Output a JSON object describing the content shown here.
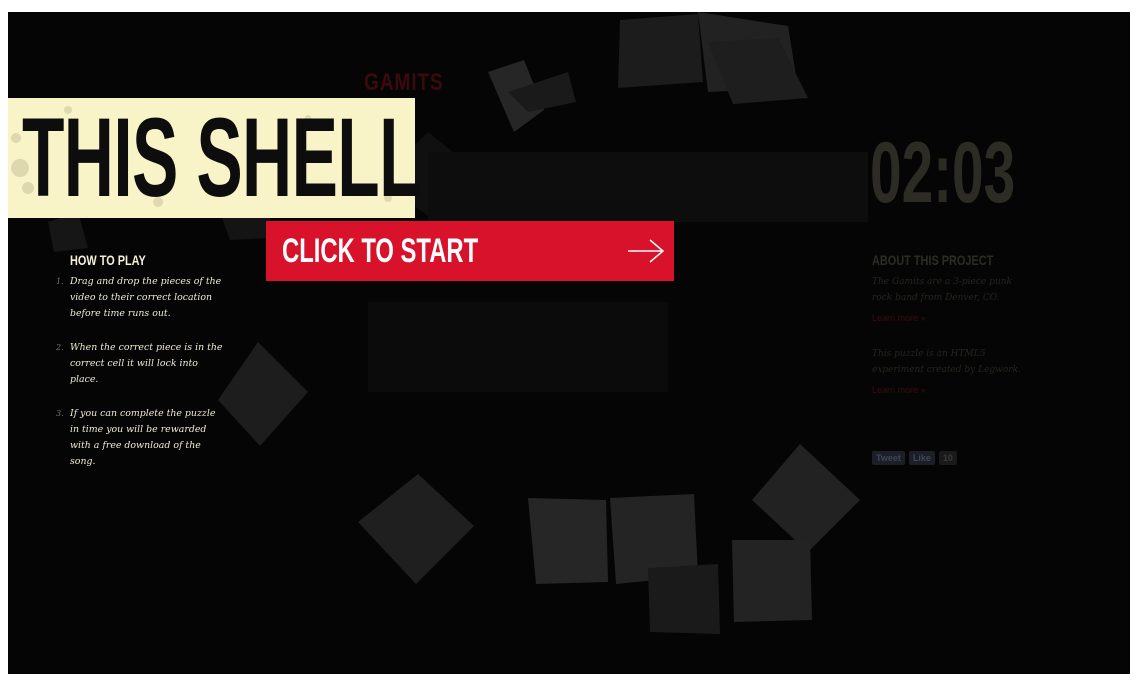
{
  "band": {
    "logo_text": "GAMITS"
  },
  "title": {
    "text": "THIS SHELL"
  },
  "start_button": {
    "label": "CLICK TO START"
  },
  "timer": {
    "value": "02:03"
  },
  "how_to_play": {
    "heading": "HOW TO PLAY",
    "steps": [
      {
        "num": "1.",
        "text": "Drag and drop the pieces of the video to their correct location before time runs out."
      },
      {
        "num": "2.",
        "text": "When the correct piece is in the correct cell it will lock into place."
      },
      {
        "num": "3.",
        "text": "If you can complete the puzzle in time you will be rewarded with a free download of the song."
      }
    ]
  },
  "about": {
    "heading": "ABOUT THIS PROJECT",
    "paragraph_1": "The Gamits are a 3-piece punk rock band from Denver, CO.",
    "link_1": "Learn more »",
    "paragraph_2": "This puzzle is an HTML5 experiment created by Legwork.",
    "link_2": "Learn more »"
  },
  "share": {
    "tweet": "Tweet",
    "like": "Like",
    "like_count": "10"
  },
  "colors": {
    "background": "#050505",
    "title_bg": "#f8f4c8",
    "accent_red": "#d7122a",
    "timer": "#2c2b24"
  }
}
